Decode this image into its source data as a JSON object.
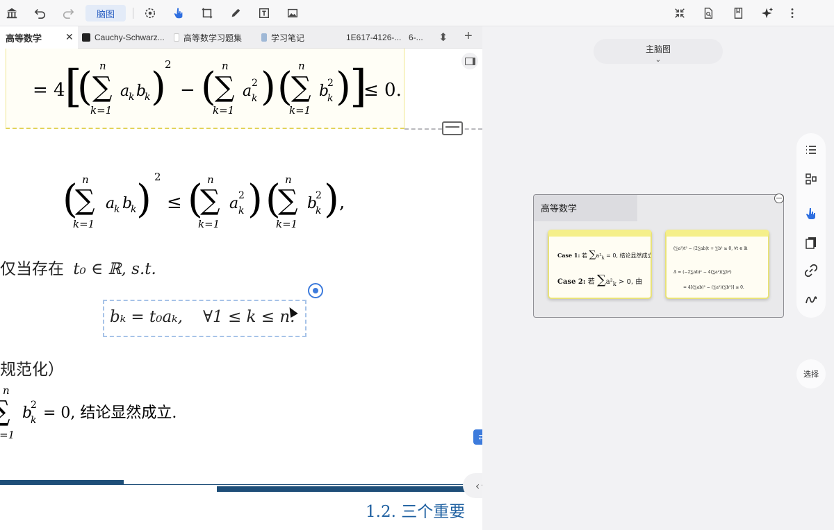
{
  "toolbar": {
    "mode_label": "脑图",
    "left_icons": [
      "library-icon",
      "undo-icon",
      "redo-icon"
    ],
    "tool_icons": [
      "lasso-icon",
      "hand-pointer-icon",
      "crop-icon",
      "pen-icon",
      "text-box-icon",
      "image-icon"
    ],
    "right_icons": [
      "collapse-icon",
      "search-doc-icon",
      "bookmark-icon",
      "ai-sparkle-icon",
      "more-icon"
    ]
  },
  "tabs": [
    {
      "label": "高等数学",
      "active": true
    },
    {
      "label": "Cauchy-Schwarz...",
      "active": false
    },
    {
      "label": "高等数学习题集",
      "active": false
    },
    {
      "label": "学习笔记",
      "active": false
    },
    {
      "label": "1E617-4126-...",
      "active": false
    },
    {
      "label": "6-...",
      "active": false
    }
  ],
  "document": {
    "eq1": {
      "prefix": "= 4",
      "sum": "∑",
      "top": "n",
      "bottom": "k=1",
      "t1": "a",
      "t1s": "k",
      "t2": "b",
      "t2s": "k",
      "pow": "2",
      "minus": "−",
      "a2": "a",
      "a2s": "k",
      "a2p": "2",
      "b2": "b",
      "b2s": "k",
      "b2p": "2",
      "rel": "≤ 0."
    },
    "eq2": {
      "rel": "≤",
      "comma": ","
    },
    "line_t0": "仅当存在",
    "line_t0_math": "t₀ ∈ ℝ, s.t.",
    "eq3": "bₖ = t₀aₖ,    ∀1 ≤ k ≤ n.",
    "heading_fragment": "规范化）",
    "sum_line": {
      "top": "n",
      "bottom": "k=1",
      "expr_tail": "= 0, 结论显然成立."
    },
    "section": "1.2.   三个重要"
  },
  "canvas": {
    "map_title": "主脑图",
    "node_title": "高等数学",
    "card1": {
      "case1": "Case 1:",
      "case1_text": "若",
      "case1_tail": "= 0, 结论显然成立.",
      "case2": "Case 2:",
      "case2_text": "若",
      "case2_tail": "> 0, 由"
    },
    "card2": {
      "line1_tail": "≥ 0,   ∀t ∈ ℝ",
      "delta": "Δ ="
    },
    "select_label": "选择",
    "side_icons": [
      "list-icon",
      "layout-icon",
      "hand-pointer-icon",
      "document-icon",
      "link-icon",
      "curve-icon"
    ]
  }
}
